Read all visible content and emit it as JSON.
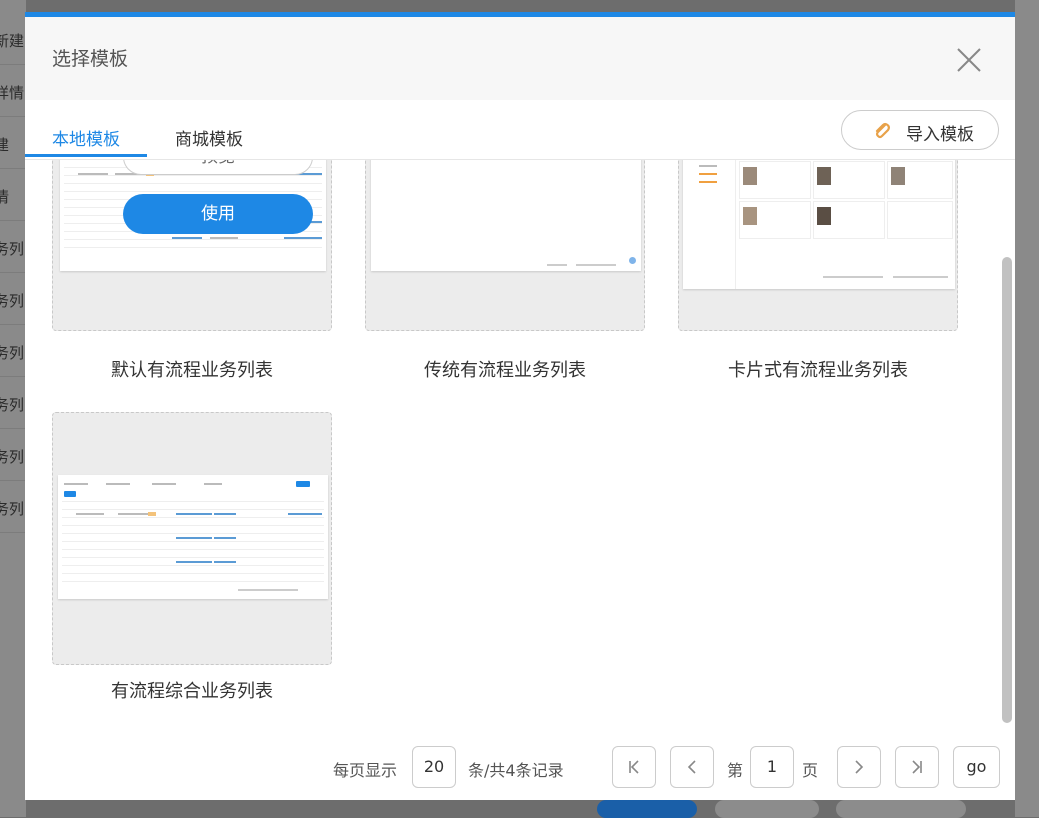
{
  "background": {
    "left_rows": [
      "新建",
      "详情",
      "建",
      "情",
      "务列",
      "务列",
      "务列",
      "务列",
      "务列",
      "务列"
    ]
  },
  "dialog": {
    "title": "选择模板",
    "accent_color": "#1e88e5",
    "close_icon": "close-icon"
  },
  "tabs": {
    "local": "本地模板",
    "mall": "商城模板",
    "active": "本地模板"
  },
  "import_button": {
    "label": "导入模板",
    "icon": "paperclip-icon"
  },
  "hover_actions": {
    "preview": "预览",
    "use": "使用"
  },
  "templates": [
    {
      "name": "默认有流程业务列表"
    },
    {
      "name": "传统有流程业务列表"
    },
    {
      "name": "卡片式有流程业务列表"
    },
    {
      "name": "有流程综合业务列表"
    }
  ],
  "pagination": {
    "per_page_label": "每页显示",
    "per_page_value": "20",
    "summary": "条/共4条记录",
    "page_prefix": "第",
    "page_value": "1",
    "page_suffix": "页",
    "go_label": "go"
  }
}
